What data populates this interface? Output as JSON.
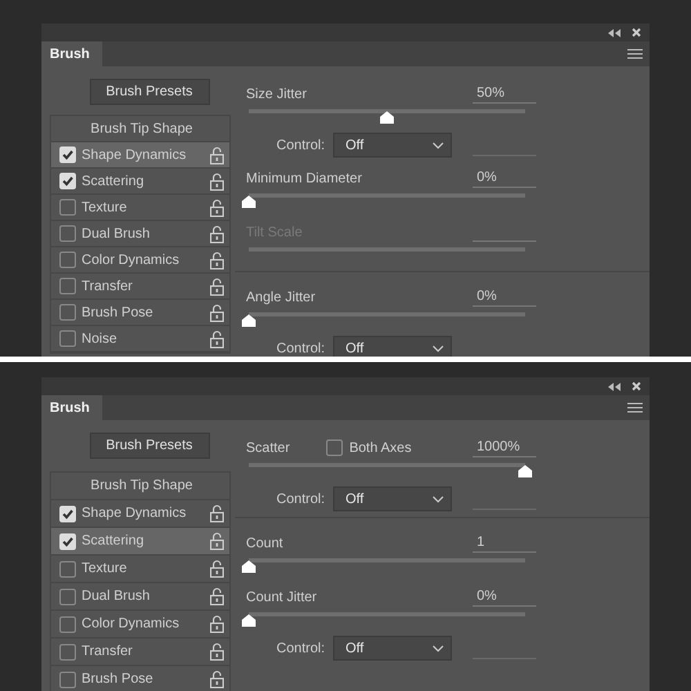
{
  "panels": [
    {
      "tab": "Brush",
      "presets_button": "Brush Presets",
      "brush_settings": [
        {
          "kind": "header",
          "label": "Brush Tip Shape",
          "selected": false
        },
        {
          "kind": "option",
          "label": "Shape Dynamics",
          "checked": true,
          "selected": true
        },
        {
          "kind": "option",
          "label": "Scattering",
          "checked": true,
          "selected": false
        },
        {
          "kind": "option",
          "label": "Texture",
          "checked": false,
          "selected": false
        },
        {
          "kind": "option",
          "label": "Dual Brush",
          "checked": false,
          "selected": false
        },
        {
          "kind": "option",
          "label": "Color Dynamics",
          "checked": false,
          "selected": false
        },
        {
          "kind": "option",
          "label": "Transfer",
          "checked": false,
          "selected": false
        },
        {
          "kind": "option",
          "label": "Brush Pose",
          "checked": false,
          "selected": false
        },
        {
          "kind": "option",
          "label": "Noise",
          "checked": false,
          "selected": false
        }
      ],
      "controls": [
        {
          "kind": "slider",
          "label": "Size Jitter",
          "value": "50%",
          "level": 0.5,
          "disabled": false
        },
        {
          "kind": "control",
          "label": "Control:",
          "value": "Off"
        },
        {
          "kind": "slider",
          "label": "Minimum Diameter",
          "value": "0%",
          "level": 0,
          "disabled": false
        },
        {
          "kind": "slider",
          "label": "Tilt Scale",
          "disabled": true
        },
        {
          "kind": "divider"
        },
        {
          "kind": "slider",
          "label": "Angle Jitter",
          "value": "0%",
          "level": 0,
          "disabled": false
        },
        {
          "kind": "control",
          "label": "Control:",
          "value": "Off"
        }
      ]
    },
    {
      "tab": "Brush",
      "presets_button": "Brush Presets",
      "brush_settings": [
        {
          "kind": "header",
          "label": "Brush Tip Shape",
          "selected": false
        },
        {
          "kind": "option",
          "label": "Shape Dynamics",
          "checked": true,
          "selected": false
        },
        {
          "kind": "option",
          "label": "Scattering",
          "checked": true,
          "selected": true
        },
        {
          "kind": "option",
          "label": "Texture",
          "checked": false,
          "selected": false
        },
        {
          "kind": "option",
          "label": "Dual Brush",
          "checked": false,
          "selected": false
        },
        {
          "kind": "option",
          "label": "Color Dynamics",
          "checked": false,
          "selected": false
        },
        {
          "kind": "option",
          "label": "Transfer",
          "checked": false,
          "selected": false
        },
        {
          "kind": "option",
          "label": "Brush Pose",
          "checked": false,
          "selected": false
        }
      ],
      "controls": [
        {
          "kind": "slider",
          "label": "Scatter",
          "value": "1000%",
          "level": 1,
          "disabled": false,
          "option": {
            "label": "Both Axes",
            "checked": false
          }
        },
        {
          "kind": "control",
          "label": "Control:",
          "value": "Off"
        },
        {
          "kind": "divider"
        },
        {
          "kind": "slider",
          "label": "Count",
          "value": "1",
          "level": 0,
          "disabled": false
        },
        {
          "kind": "slider",
          "label": "Count Jitter",
          "value": "0%",
          "level": 0,
          "disabled": false
        },
        {
          "kind": "control",
          "label": "Control:",
          "value": "Off"
        }
      ]
    }
  ]
}
